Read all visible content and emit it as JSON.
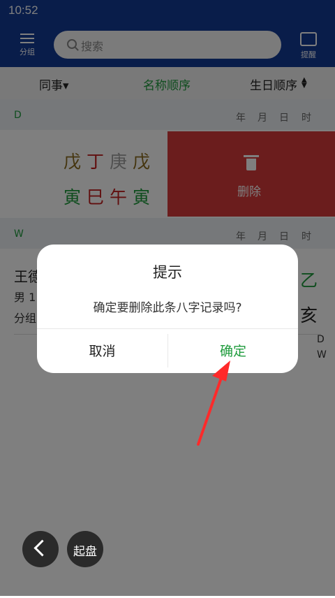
{
  "status": {
    "time": "10:52"
  },
  "header": {
    "menu_label": "分组",
    "search_placeholder": "搜索",
    "remind_label": "提醒"
  },
  "filters": {
    "group": "同事▾",
    "name_order": "名称顺序",
    "birthday_order": "生日顺序"
  },
  "sections": [
    {
      "letter": "D",
      "cols": [
        "年",
        "月",
        "日",
        "时"
      ]
    },
    {
      "letter": "W",
      "cols": [
        "年",
        "月",
        "日",
        "时"
      ]
    }
  ],
  "row1": {
    "stems": [
      {
        "char": "戊",
        "color": "#8b6b1e"
      },
      {
        "char": "丁",
        "color": "#c21f1f"
      },
      {
        "char": "庚",
        "color": "#a0a0a0"
      },
      {
        "char": "戊",
        "color": "#8b6b1e"
      }
    ],
    "branches": [
      {
        "char": "寅",
        "color": "#1e9b3c"
      },
      {
        "char": "巳",
        "color": "#c21f1f"
      },
      {
        "char": "午",
        "color": "#c21f1f"
      },
      {
        "char": "寅",
        "color": "#1e9b3c"
      }
    ],
    "delete_label": "删除"
  },
  "row3": {
    "name": "王德",
    "gender_line": "男 1",
    "group_line": "分组",
    "right_stem": {
      "char": "乙",
      "color": "#1e9b3c"
    },
    "right_branch": {
      "char": "亥",
      "color": "#222222"
    },
    "index_letters": [
      "D",
      "W"
    ]
  },
  "dialog": {
    "title": "提示",
    "message": "确定要删除此条八字记录吗?",
    "cancel": "取消",
    "confirm": "确定"
  },
  "fab": {
    "start": "起盘"
  },
  "colors": {
    "accent_green": "#1e9b3c",
    "header_blue": "#123a95",
    "delete_red": "#d63a3a"
  }
}
